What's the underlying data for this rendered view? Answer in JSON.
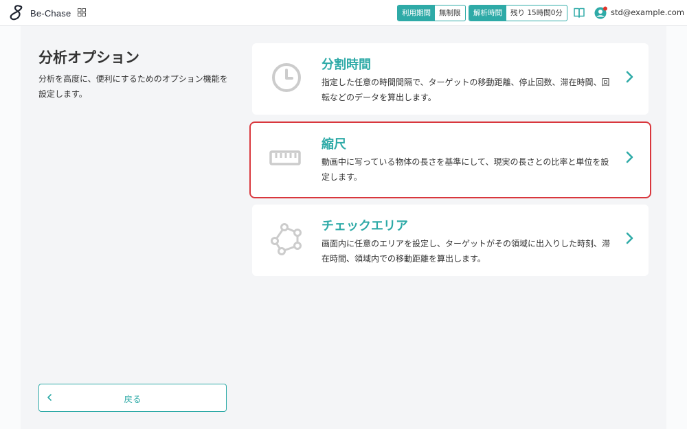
{
  "header": {
    "logo_text": "Be-Chase",
    "usage": {
      "label": "利用期間",
      "value": "無制限"
    },
    "analysis": {
      "label": "解析時間",
      "value": "残り 15時間0分"
    },
    "user_email": "std@example.com",
    "notification_dot_color": "#e0352b"
  },
  "sidebar": {
    "title": "分析オプション",
    "description": "分析を高度に、便利にするためのオプション機能を設定します。",
    "back_label": "戻る"
  },
  "options": [
    {
      "title": "分割時間",
      "description": "指定した任意の時間間隔で、ターゲットの移動距離、停止回数、滞在時間、回転などのデータを算出します。",
      "icon": "clock-icon"
    },
    {
      "title": "縮尺",
      "description": "動画中に写っている物体の長さを基準にして、現実の長さとの比率と単位を設定します。",
      "icon": "ruler-icon",
      "selected": true
    },
    {
      "title": "チェックエリア",
      "description": "画面内に任意のエリアを設定し、ターゲットがその領域に出入りした時刻、滞在時間、領域内での移動距離を算出します。",
      "icon": "polygon-area-icon"
    }
  ],
  "colors": {
    "accent": "#2eaaa7",
    "selection_outline": "#d9373d",
    "icon_gray": "#cccccc"
  }
}
